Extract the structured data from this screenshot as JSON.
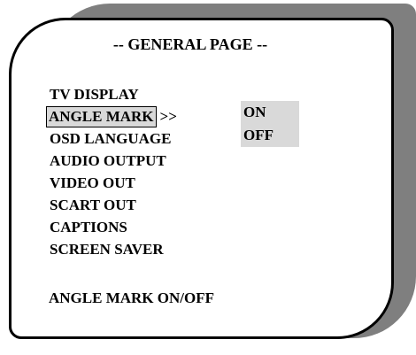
{
  "title": "-- GENERAL PAGE --",
  "menu": {
    "items": [
      {
        "label": "TV DISPLAY",
        "selected": false
      },
      {
        "label": "ANGLE MARK",
        "selected": true
      },
      {
        "label": "OSD LANGUAGE",
        "selected": false
      },
      {
        "label": "AUDIO OUTPUT",
        "selected": false
      },
      {
        "label": "VIDEO OUT",
        "selected": false
      },
      {
        "label": "SCART OUT",
        "selected": false
      },
      {
        "label": "CAPTIONS",
        "selected": false
      },
      {
        "label": "SCREEN SAVER",
        "selected": false
      }
    ],
    "selected_arrow": ">>"
  },
  "submenu": {
    "options": [
      "ON",
      "OFF"
    ]
  },
  "status_text": "ANGLE MARK ON/OFF",
  "colors": {
    "shadow": "#7f7f7f",
    "highlight": "#d9d9d9",
    "border": "#000000",
    "background": "#ffffff"
  }
}
